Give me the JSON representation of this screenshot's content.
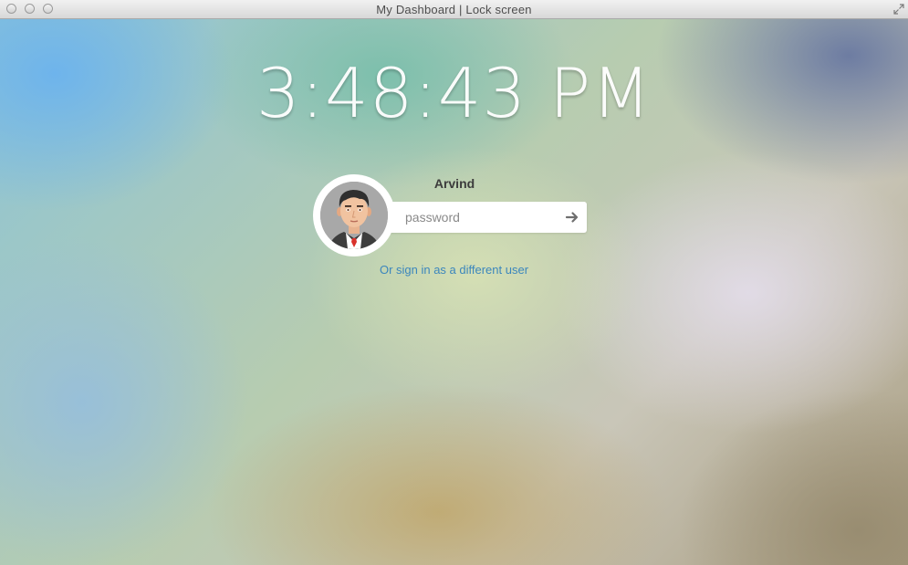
{
  "window": {
    "title": "My Dashboard | Lock screen"
  },
  "icons": {
    "fullscreen": "fullscreen-arrows-icon",
    "submit": "arrow-right-icon",
    "avatar": "user-avatar-illustration"
  },
  "lock": {
    "time": "3:48:43 PM",
    "username": "Arvind",
    "password_placeholder": "password",
    "password_value": "",
    "switch_user_label": "Or sign in as a different user"
  },
  "colors": {
    "link": "#3b86bd",
    "clock": "#ffffff"
  }
}
